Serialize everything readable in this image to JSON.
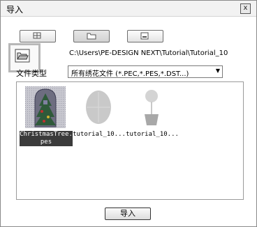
{
  "dialog": {
    "title": "导入",
    "close_glyph": "x"
  },
  "view_buttons": [
    {
      "name": "thumbnail-view-icon"
    },
    {
      "name": "folder-view-icon"
    },
    {
      "name": "preview-view-icon"
    }
  ],
  "folder_button": {
    "icon": "open-folder-icon"
  },
  "path": "C:\\Users\\PE-DESIGN NEXT\\Tutorial\\Tutorial_10",
  "filetype": {
    "label": "文件类型",
    "selected": "所有绣花文件 (*.PEC,*.PES,*.DST...)"
  },
  "files": [
    {
      "name": "ChristmasTree.pes",
      "line1": "ChristmasTree.",
      "line2": "pes",
      "selected": true
    },
    {
      "name": "tutorial_10...",
      "line1": "tutorial_10...",
      "line2": "",
      "selected": false
    },
    {
      "name": "tutorial_10...",
      "line1": "tutorial_10...",
      "line2": "",
      "selected": false
    }
  ],
  "import_button": {
    "label": "导入"
  }
}
